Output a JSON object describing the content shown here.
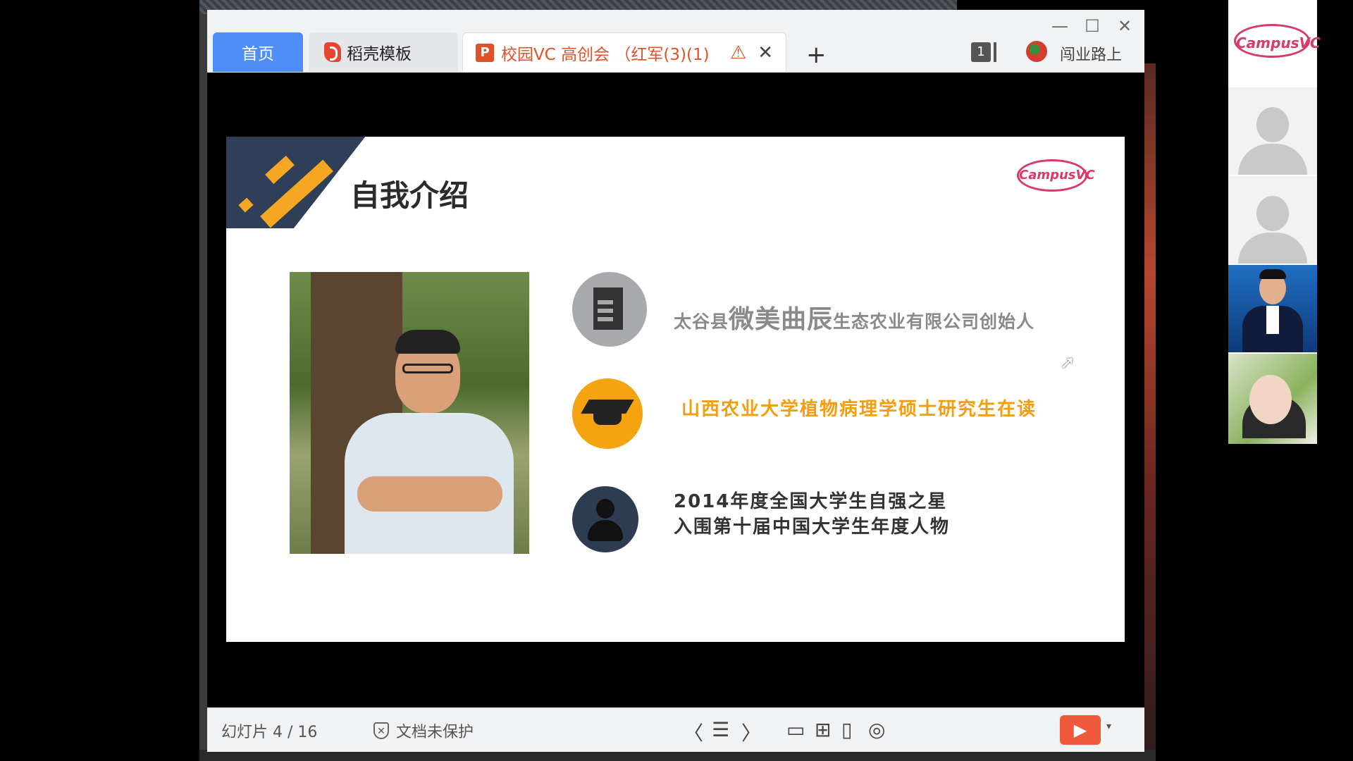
{
  "window": {
    "minimize": "—",
    "maximize": "☐",
    "close": "✕"
  },
  "tabs": [
    {
      "label": "首页"
    },
    {
      "label": "稻壳模板"
    },
    {
      "label": "校园VC 高创会  （红军(3)(1)"
    }
  ],
  "tab_warning": "⚠",
  "tab_close": "✕",
  "new_tab": "+",
  "tab_count": "1",
  "user": {
    "name": "闯业路上"
  },
  "slide": {
    "title": "自我介绍",
    "logo_text": "CampusVC",
    "line1_prefix": "太谷县",
    "line1_big": "微美曲辰",
    "line1_suffix": "生态农业有限公司创始人",
    "line2": "山西农业大学植物病理学硕士研究生在读",
    "line3a": "2014年度全国大学生自强之星",
    "line3b": "入围第十届中国大学生年度人物"
  },
  "status": {
    "slide_indicator": "幻灯片 4 / 16",
    "protection": "文档未保护",
    "prev": "〈",
    "list": "☰",
    "next": "〉",
    "play": "▶",
    "dropdown": "▾"
  },
  "sidebar": {
    "logo_text": "CampusVC"
  },
  "colors": {
    "accent_tab": "#4f8ef7",
    "doc_tab_text": "#e1522a",
    "orange_text": "#f59d0c",
    "play_button": "#f05a3c"
  }
}
